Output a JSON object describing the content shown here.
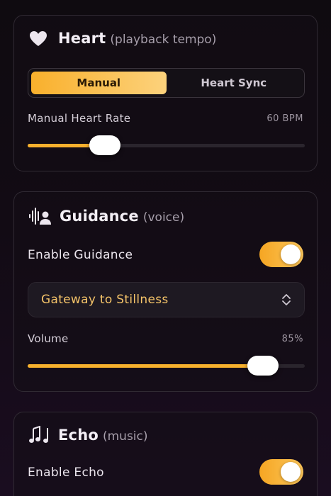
{
  "heart": {
    "title": "Heart",
    "subtitle": "(playback tempo)",
    "icon": "heart-icon",
    "modes": [
      "Manual",
      "Heart Sync"
    ],
    "active_mode": "Manual",
    "rate_label": "Manual Heart Rate",
    "rate_value": "60 BPM",
    "rate_fraction": 0.28
  },
  "guidance": {
    "title": "Guidance",
    "subtitle": "(voice)",
    "icon": "voice-guide-icon",
    "enable_label": "Enable Guidance",
    "enabled": true,
    "selected_track": "Gateway to Stillness",
    "volume_label": "Volume",
    "volume_value": "85%",
    "volume_fraction": 0.85
  },
  "echo": {
    "title": "Echo",
    "subtitle": "(music)",
    "icon": "music-notes-icon",
    "enable_label": "Enable Echo",
    "enabled": true
  },
  "colors": {
    "accent": "#f7b02d",
    "accent_light": "#fcd27c",
    "select_text": "#f4c369"
  }
}
